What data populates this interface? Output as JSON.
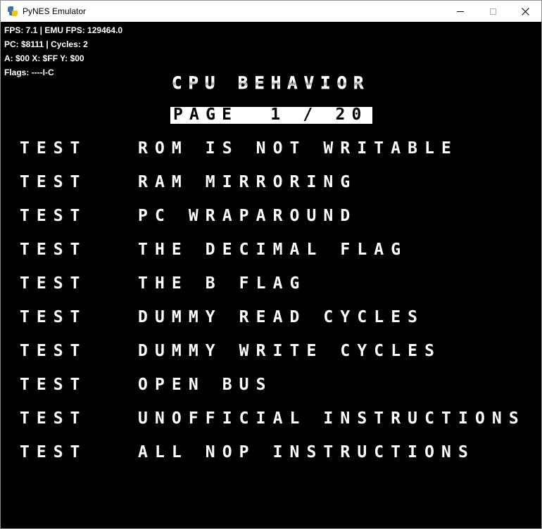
{
  "window": {
    "title": "PyNES Emulator",
    "app_icon": "python-icon",
    "controls": {
      "minimize": "minimize-icon",
      "maximize": "maximize-icon",
      "close": "close-icon"
    }
  },
  "hud": {
    "line1": "FPS: 7.1 | EMU FPS: 129464.0",
    "line2": "PC: $8111 | Cycles: 2",
    "line3": "A: $00 X: $FF Y: $00",
    "line4": "Flags: ----I-C"
  },
  "game": {
    "heading": "CPU BEHAVIOR",
    "page_label": "PAGE  1 / 20",
    "tests": [
      {
        "label": "TEST",
        "name": "ROM IS NOT WRITABLE"
      },
      {
        "label": "TEST",
        "name": "RAM MIRRORING"
      },
      {
        "label": "TEST",
        "name": "PC WRAPAROUND"
      },
      {
        "label": "TEST",
        "name": "THE DECIMAL FLAG"
      },
      {
        "label": "TEST",
        "name": "THE B FLAG"
      },
      {
        "label": "TEST",
        "name": "DUMMY READ CYCLES"
      },
      {
        "label": "TEST",
        "name": "DUMMY WRITE CYCLES"
      },
      {
        "label": "TEST",
        "name": "OPEN BUS"
      },
      {
        "label": "TEST",
        "name": "UNOFFICIAL INSTRUCTIONS"
      },
      {
        "label": "TEST",
        "name": "ALL NOP INSTRUCTIONS"
      }
    ]
  },
  "colors": {
    "screen_bg": "#000000",
    "text": "#ffffff",
    "titlebar_bg": "#ffffff"
  }
}
